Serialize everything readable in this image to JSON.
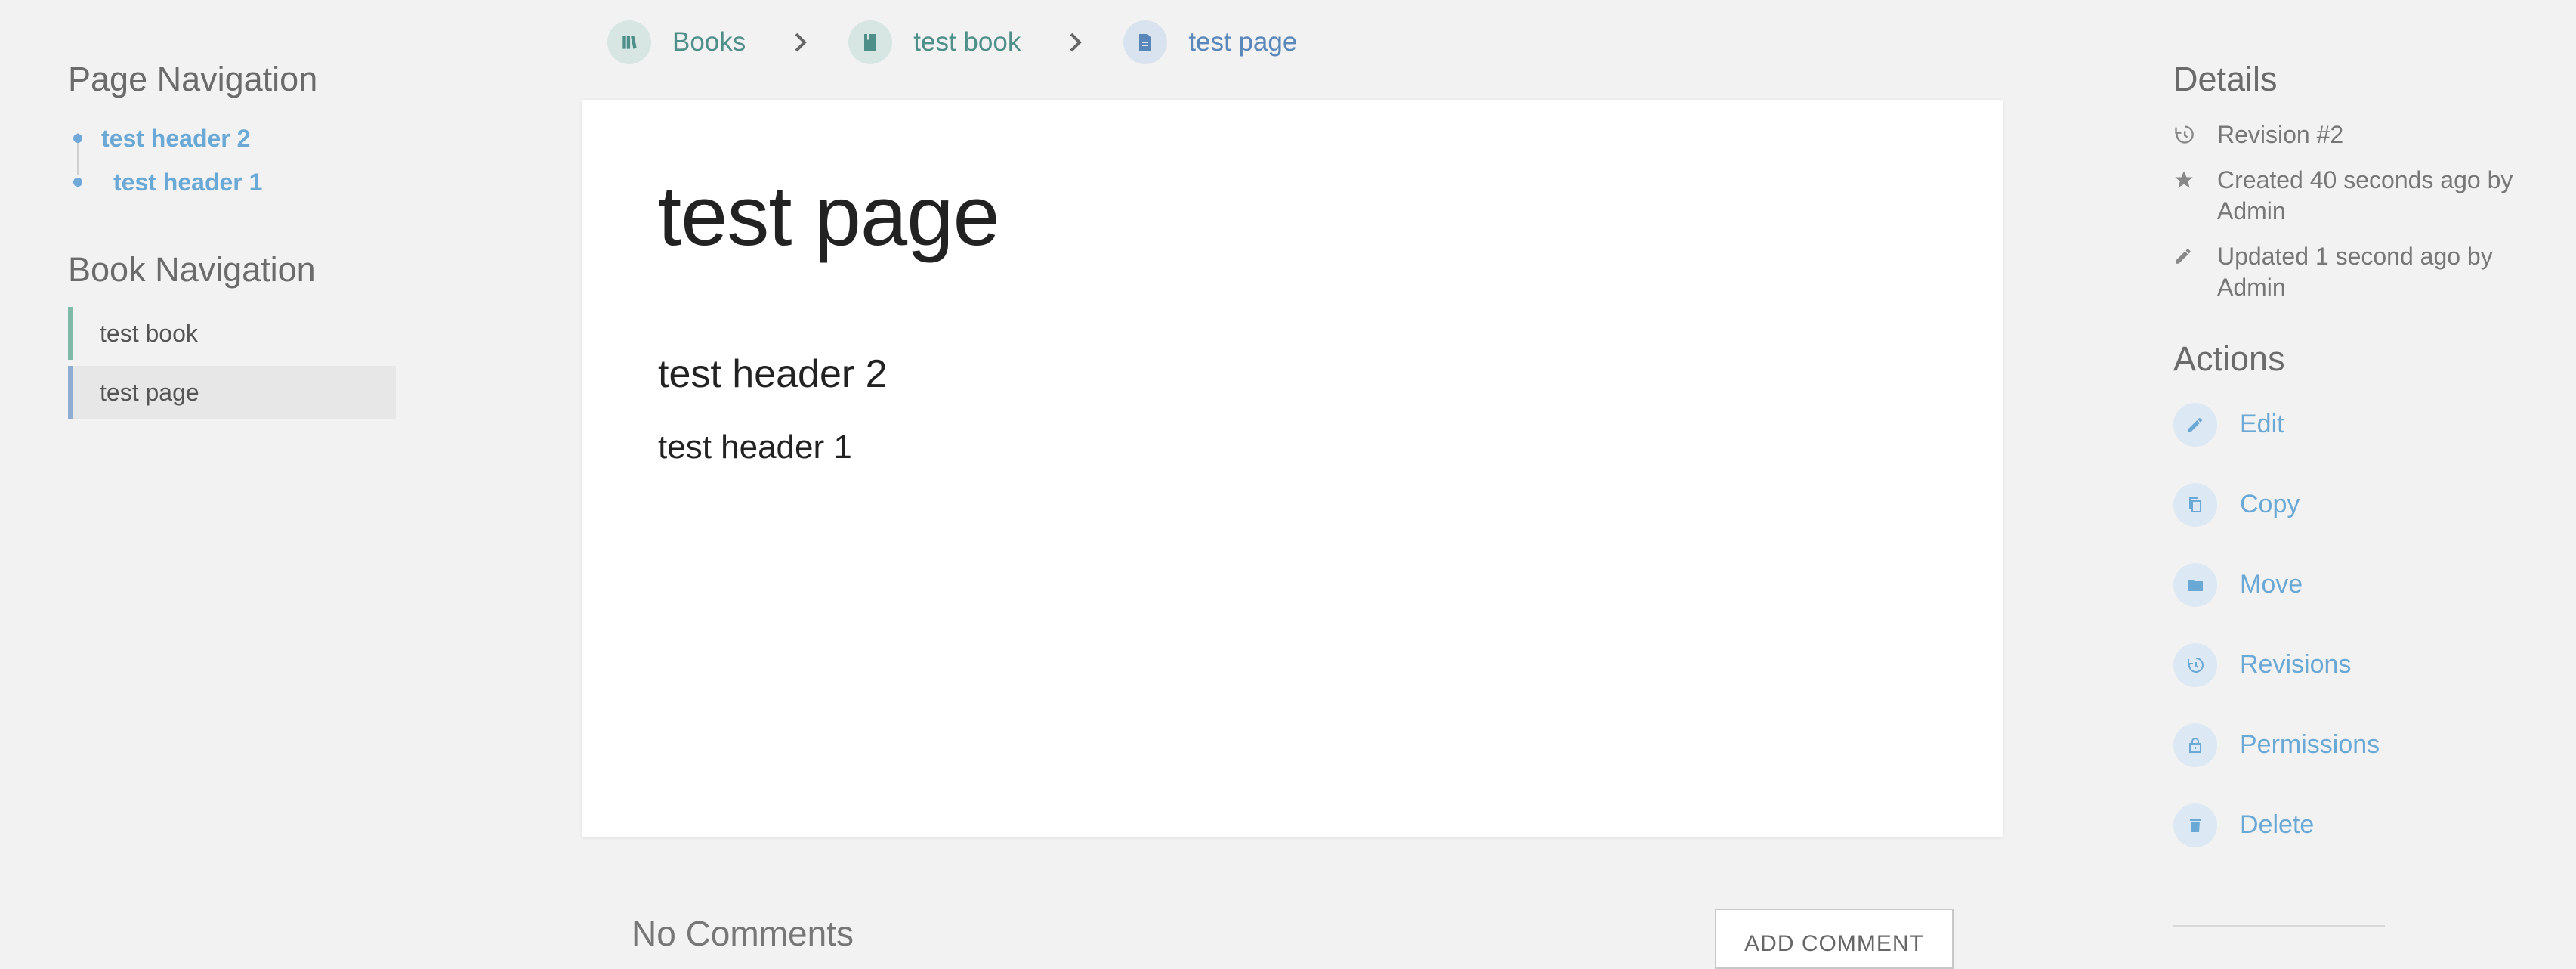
{
  "breadcrumb": {
    "books": "Books",
    "book": "test book",
    "page": "test page"
  },
  "page_navigation": {
    "heading": "Page Navigation",
    "items": [
      {
        "label": "test header 2"
      },
      {
        "label": "test header 1"
      }
    ]
  },
  "book_navigation": {
    "heading": "Book Navigation",
    "items": [
      {
        "label": "test book"
      },
      {
        "label": "test page"
      }
    ]
  },
  "content": {
    "title": "test page",
    "h2": "test header 2",
    "h1": "test header 1"
  },
  "comments": {
    "title": "No Comments",
    "add_label": "ADD COMMENT"
  },
  "details": {
    "heading": "Details",
    "revision": "Revision #2",
    "created": "Created 40 seconds ago by Admin",
    "updated": "Updated 1 second ago by Admin"
  },
  "actions": {
    "heading": "Actions",
    "edit": "Edit",
    "copy": "Copy",
    "move": "Move",
    "revisions": "Revisions",
    "permissions": "Permissions",
    "delete": "Delete"
  },
  "colors": {
    "background": "#f2f2f2",
    "link_blue": "#6aa8d6",
    "book_green": "#4f8f8a",
    "page_blue": "#5a87b9"
  }
}
